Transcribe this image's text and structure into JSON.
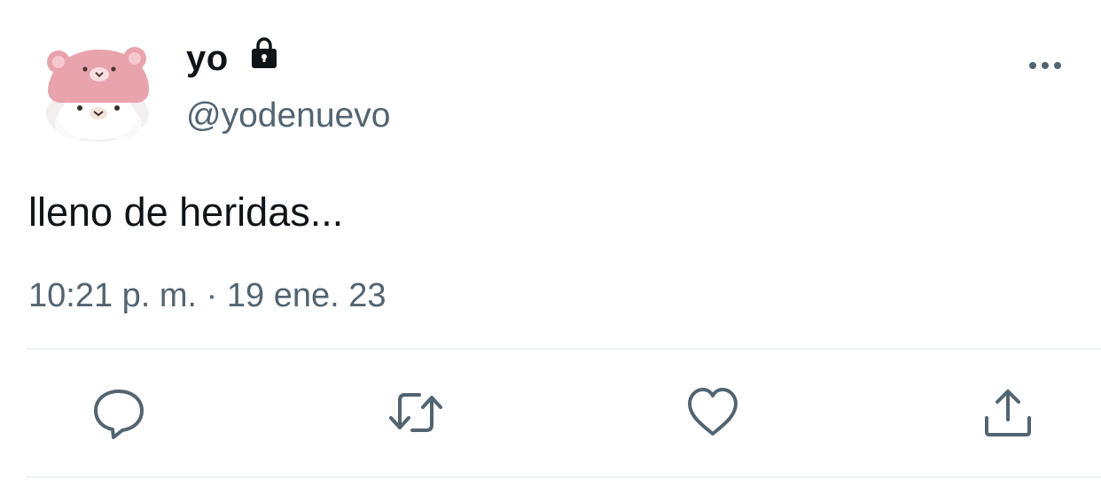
{
  "tweet": {
    "display_name": "yo",
    "handle": "@yodenuevo",
    "text": "lleno de heridas...",
    "timestamp": "10:21 p. m. · 19 ene. 23",
    "account_locked": true
  },
  "icons": {
    "lock": "lock-icon",
    "more": "more-horizontal-icon",
    "reply": "reply-bubble-icon",
    "retweet": "retweet-icon",
    "like": "heart-icon",
    "share": "share-upload-icon"
  },
  "colors": {
    "text_primary": "#0f1419",
    "text_secondary": "#536471",
    "icon": "#536471",
    "divider": "#eff3f4",
    "avatar_pink": "#e8a3ac"
  }
}
